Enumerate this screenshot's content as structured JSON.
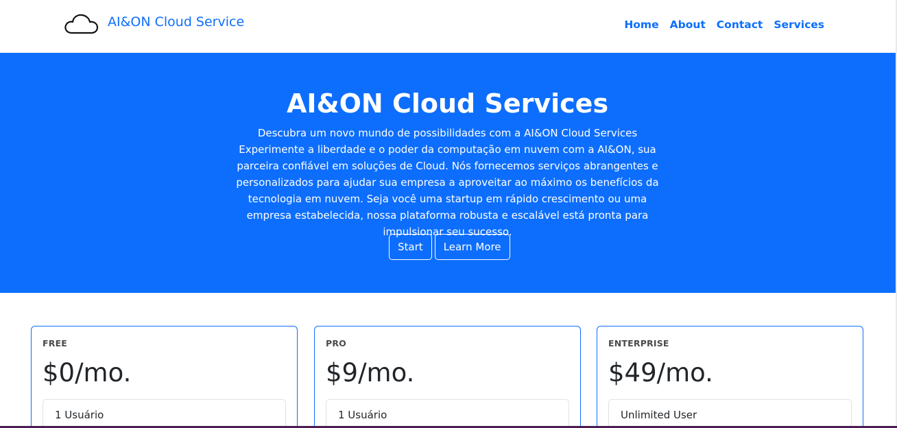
{
  "navbar": {
    "brand_text": "AI&ON Cloud Service",
    "brand_icon": "cloud-icon",
    "links": [
      "Home",
      "About",
      "Contact",
      "Services"
    ]
  },
  "hero": {
    "title": "AI&ON Cloud Services",
    "description": "Descubra um novo mundo de possibilidades com a AI&ON Cloud Services Experimente a liberdade e o poder da computação em nuvem com a AI&ON, sua parceira confiável em soluções de Cloud. Nós fornecemos serviços abrangentes e personalizados para ajudar sua empresa a aproveitar ao máximo os benefícios da tecnologia em nuvem. Seja você uma startup em rápido crescimento ou uma empresa estabelecida, nossa plataforma robusta e escalável está pronta para impulsionar seu sucesso.",
    "buttons": [
      "Start",
      "Learn More"
    ]
  },
  "pricing": {
    "plans": [
      {
        "tier": "FREE",
        "price": "$0/mo.",
        "feature": "1 Usuário"
      },
      {
        "tier": "PRO",
        "price": "$9/mo.",
        "feature": "1 Usuário"
      },
      {
        "tier": "ENTERPRISE",
        "price": "$49/mo.",
        "feature": "Unlimited User"
      }
    ]
  },
  "colors": {
    "primary": "#0d6efd",
    "white": "#ffffff",
    "text": "#212529"
  }
}
